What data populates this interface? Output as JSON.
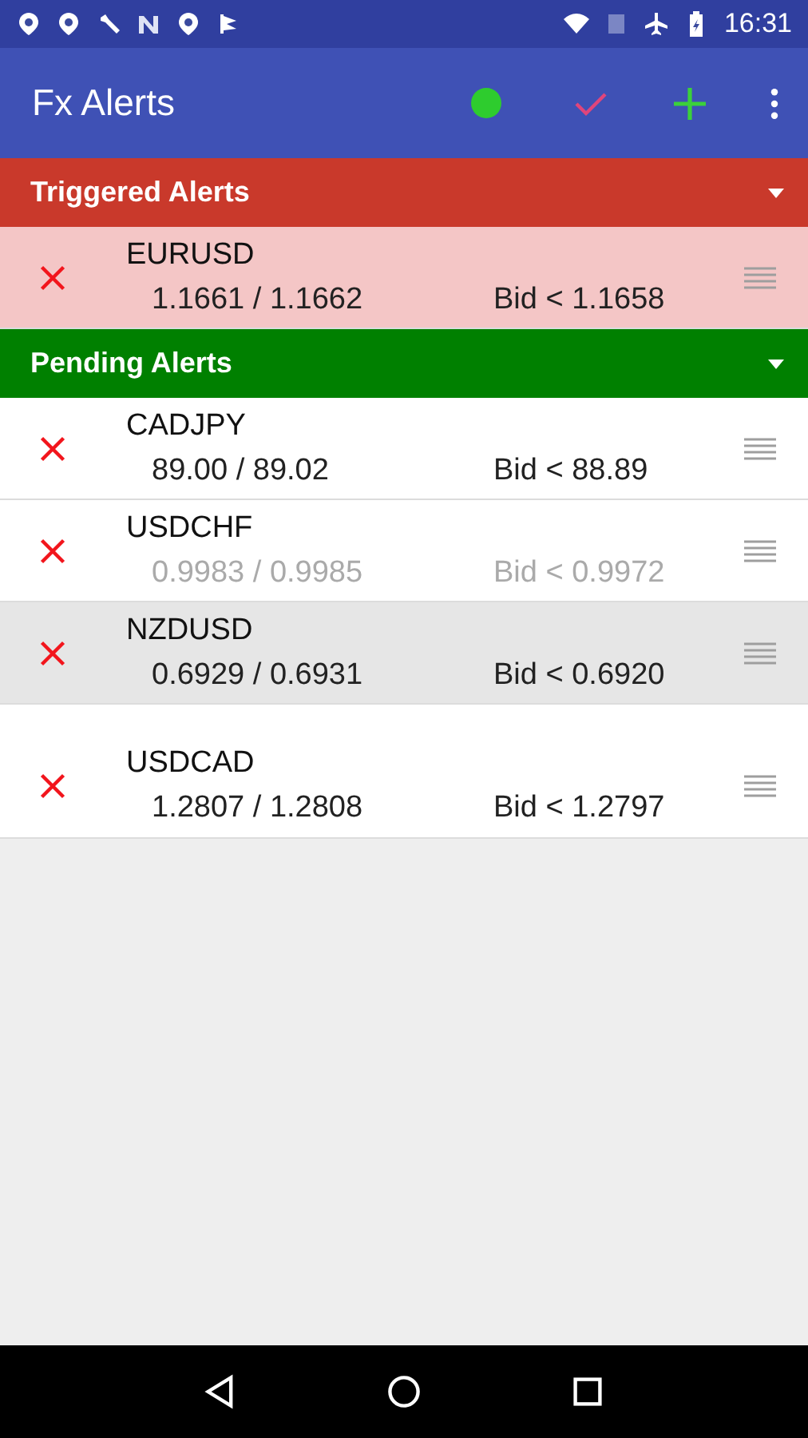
{
  "status_bar": {
    "time": "16:31"
  },
  "app_bar": {
    "title": "Fx Alerts",
    "connected": true
  },
  "sections": [
    {
      "kind": "triggered",
      "title": "Triggered Alerts",
      "expanded": true,
      "alerts": [
        {
          "pair": "EURUSD",
          "price": "1.1661 / 1.1662",
          "condition": "Bid < 1.1658",
          "dragging": false,
          "faded": false
        }
      ]
    },
    {
      "kind": "pending",
      "title": "Pending Alerts",
      "expanded": true,
      "alerts": [
        {
          "pair": "CADJPY",
          "price": "89.00 / 89.02",
          "condition": "Bid < 88.89",
          "dragging": false,
          "faded": false
        },
        {
          "pair": "USDCHF",
          "price": "0.9983 / 0.9985",
          "condition": "Bid < 0.9972",
          "dragging": false,
          "faded": true
        },
        {
          "pair": "NZDUSD",
          "price": "0.6929 / 0.6931",
          "condition": "Bid < 0.6920",
          "dragging": true,
          "faded": false
        },
        {
          "pair": "USDCAD",
          "price": "1.2807 / 1.2808",
          "condition": "Bid < 1.2797",
          "dragging": false,
          "faded": false
        }
      ]
    }
  ]
}
